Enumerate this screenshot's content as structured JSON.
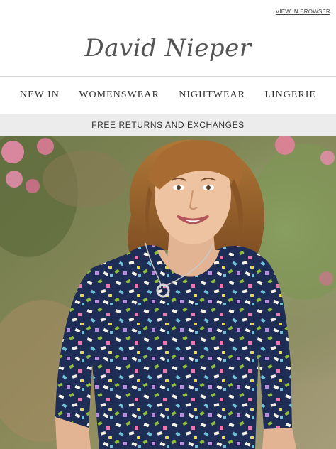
{
  "header": {
    "view_in_browser": "VIEW IN BROWSER",
    "logo_text": "David Nieper"
  },
  "nav": {
    "items": [
      {
        "label": "NEW IN"
      },
      {
        "label": "WOMENSWEAR"
      },
      {
        "label": "NIGHTWEAR"
      },
      {
        "label": "LINGERIE"
      }
    ]
  },
  "promo": {
    "text": "FREE RETURNS AND EXCHANGES"
  },
  "colors": {
    "promo_bg": "#ececec",
    "dress_navy": "#1e2d55"
  }
}
